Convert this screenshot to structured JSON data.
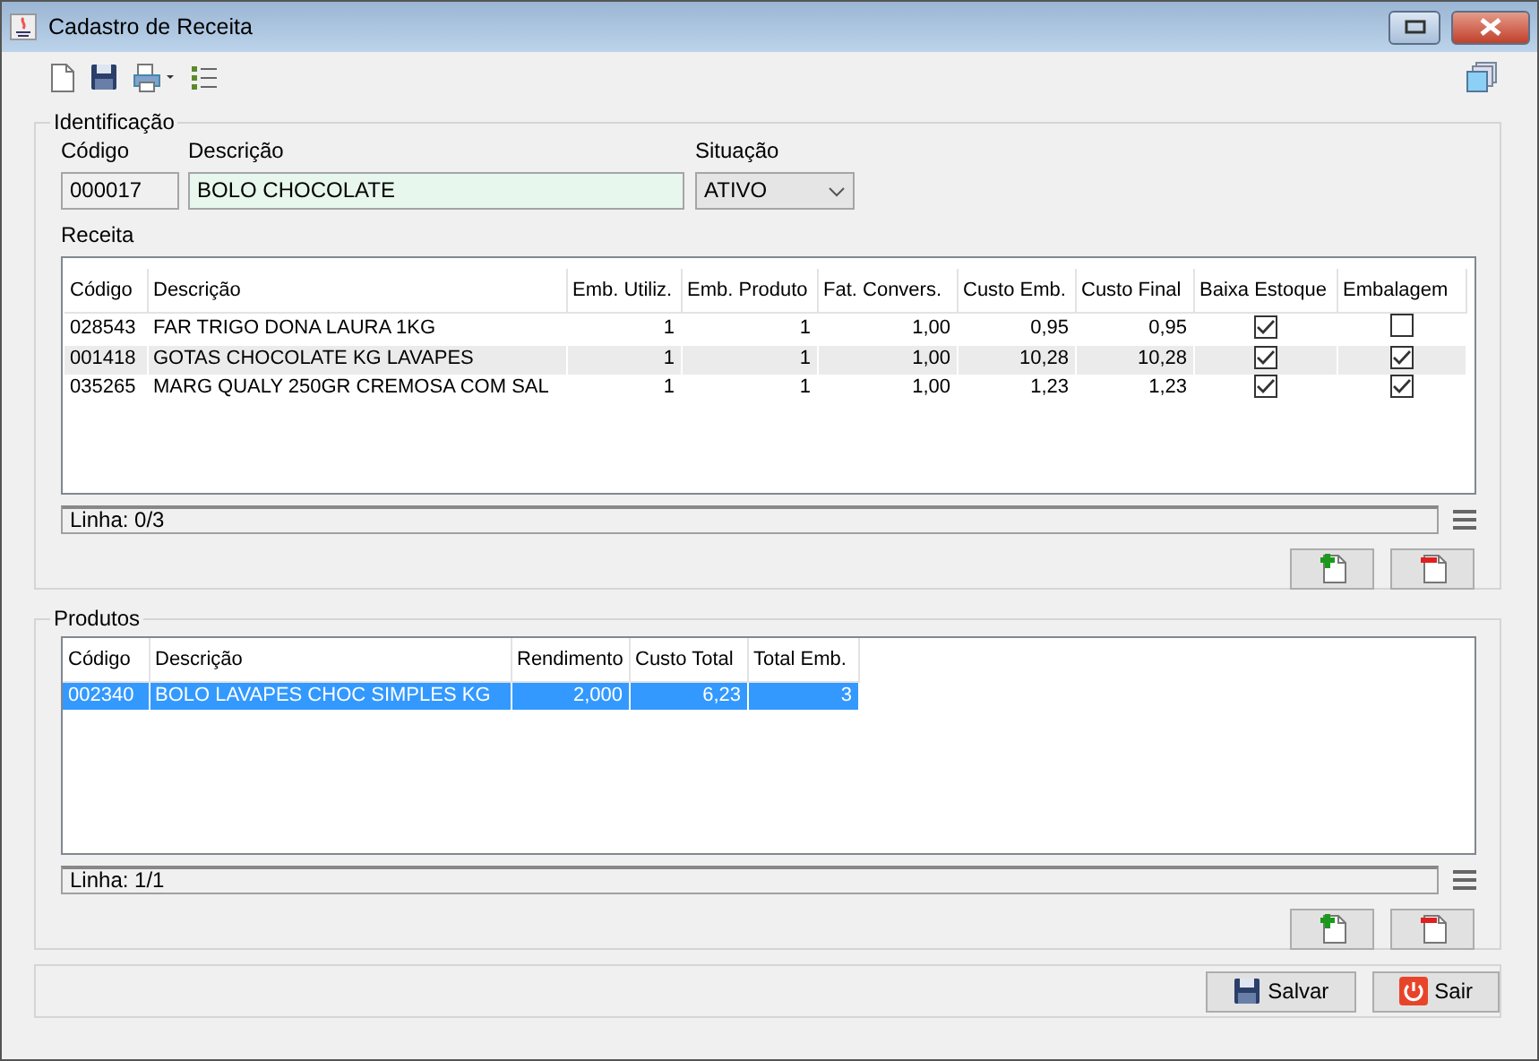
{
  "window": {
    "title": "Cadastro de Receita"
  },
  "identificacao": {
    "legend": "Identificação",
    "codigo_label": "Código",
    "codigo": "000017",
    "descricao_label": "Descrição",
    "descricao": "BOLO CHOCOLATE",
    "situacao_label": "Situação",
    "situacao": "ATIVO"
  },
  "receita": {
    "label": "Receita",
    "columns": [
      "Código",
      "Descrição",
      "Emb. Utiliz.",
      "Emb. Produto",
      "Fat. Convers.",
      "Custo Emb.",
      "Custo Final",
      "Baixa Estoque",
      "Embalagem"
    ],
    "rows": [
      {
        "cells": [
          "028543",
          "FAR TRIGO DONA LAURA 1KG",
          "1",
          "1",
          "1,00",
          "0,95",
          "0,95"
        ],
        "baixa_estoque": true,
        "embalagem": false,
        "selected": false
      },
      {
        "cells": [
          "001418",
          "GOTAS CHOCOLATE KG LAVAPES",
          "1",
          "1",
          "1,00",
          "10,28",
          "10,28"
        ],
        "baixa_estoque": true,
        "embalagem": true,
        "selected": false
      },
      {
        "cells": [
          "035265",
          "MARG QUALY 250GR CREMOSA COM SAL",
          "1",
          "1",
          "1,00",
          "1,23",
          "1,23"
        ],
        "baixa_estoque": true,
        "embalagem": true,
        "selected": false
      }
    ],
    "status": "Linha: 0/3"
  },
  "produtos": {
    "legend": "Produtos",
    "columns": [
      "Código",
      "Descrição",
      "Rendimento",
      "Custo Total",
      "Total Emb."
    ],
    "rows": [
      {
        "cells": [
          "002340",
          "BOLO LAVAPES CHOC SIMPLES KG",
          "2,000",
          "6,23",
          "3"
        ],
        "selected": true
      }
    ],
    "status": "Linha: 1/1"
  },
  "buttons": [
    {
      "kind": "save",
      "label": "Salvar"
    },
    {
      "kind": "exit",
      "label": "Sair"
    }
  ]
}
